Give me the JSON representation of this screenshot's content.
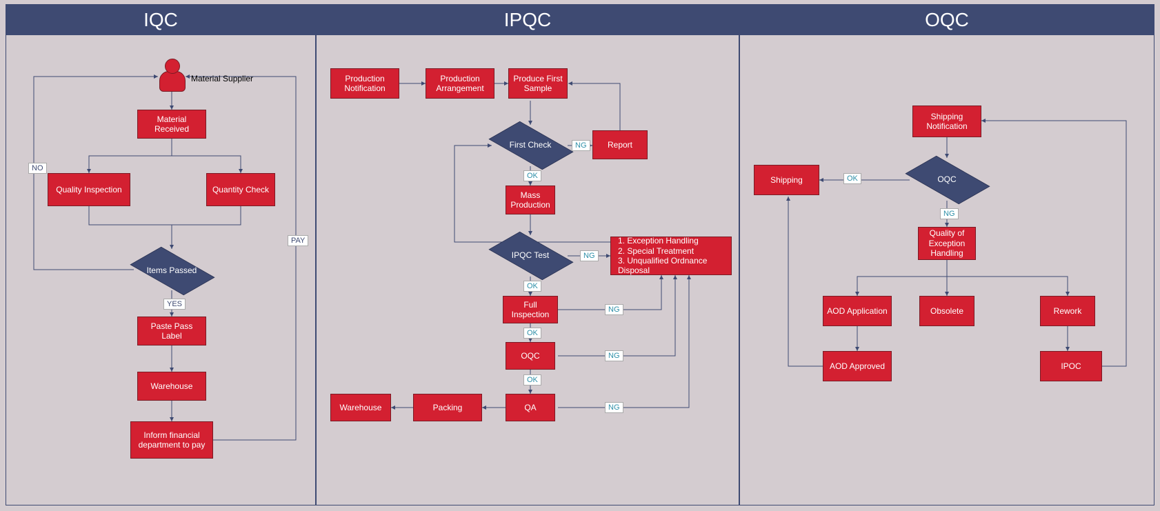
{
  "lanes": {
    "iqc": {
      "title": "IQC"
    },
    "ipqc": {
      "title": "IPQC"
    },
    "oqc": {
      "title": "OQC"
    }
  },
  "iqc": {
    "supplier_caption": "Material Supplier",
    "material_received": "Material Received",
    "quality_inspection": "Quality Inspection",
    "quantity_check": "Quantity Check",
    "items_passed": "Items Passed",
    "paste_pass": "Paste Pass Label",
    "warehouse": "Warehouse",
    "inform_pay": "Inform financial department to pay",
    "edge_no": "NO",
    "edge_yes": "YES",
    "edge_pay": "PAY"
  },
  "ipqc": {
    "prod_notification": "Production Notification",
    "prod_arrangement": "Production Arrangement",
    "first_sample": "Produce First Sample",
    "first_check": "First Check",
    "report": "Report",
    "mass_prod": "Mass Production",
    "ipqc_test": "IPQC Test",
    "full_inspection": "Full Inspection",
    "oqc": "OQC",
    "qa": "QA",
    "packing": "Packing",
    "warehouse": "Warehouse",
    "exception_list": "1. Exception Handling\n2. Special Treatment\n3. Unqualified Ordnance Disposal",
    "ok": "OK",
    "ng": "NG"
  },
  "oqc": {
    "ship_notification": "Shipping Notification",
    "oqc_dec": "OQC",
    "shipping": "Shipping",
    "quality_exc": "Quality of Exception Handling",
    "aod_app": "AOD Application",
    "obsolete": "Obsolete",
    "rework": "Rework",
    "aod_approved": "AOD Approved",
    "ipoc": "IPOC",
    "ok": "OK",
    "ng": "NG"
  }
}
